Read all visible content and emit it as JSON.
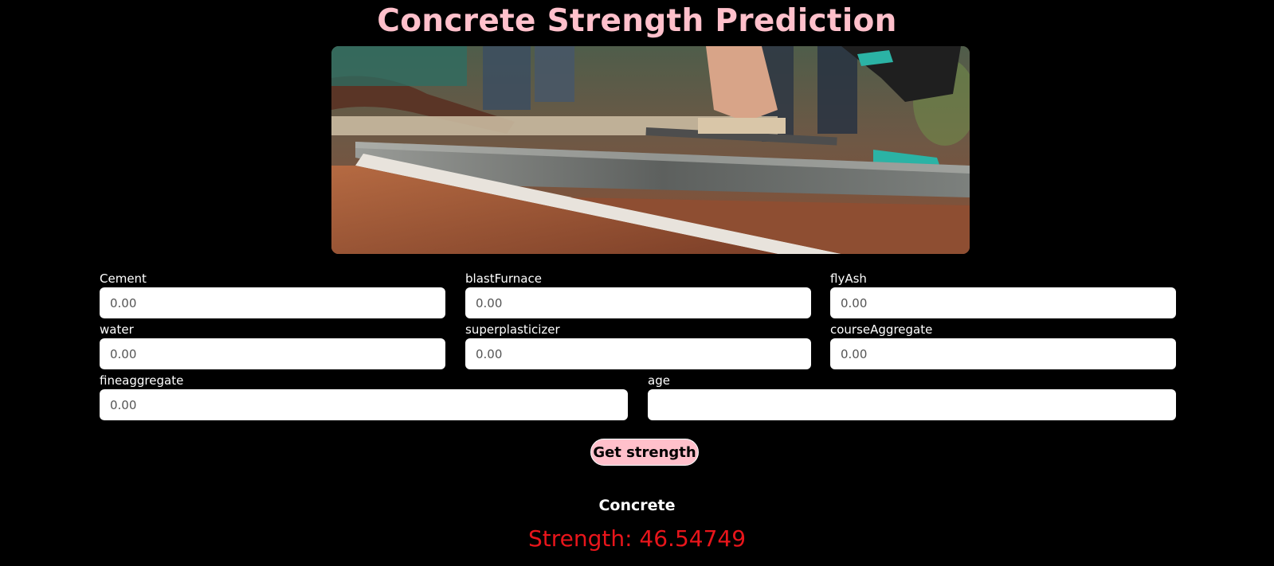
{
  "page": {
    "title": "Concrete Strength Prediction"
  },
  "hero_image": {
    "description_icon": "concrete-pouring-photo"
  },
  "form": {
    "fields": {
      "cement": {
        "label": "Cement",
        "placeholder": "0.00"
      },
      "blast_furnace": {
        "label": "blastFurnace",
        "placeholder": "0.00"
      },
      "fly_ash": {
        "label": "flyAsh",
        "placeholder": "0.00"
      },
      "water": {
        "label": "water",
        "placeholder": "0.00"
      },
      "superplasticizer": {
        "label": "superplasticizer",
        "placeholder": "0.00"
      },
      "course_aggregate": {
        "label": "courseAggregate",
        "placeholder": "0.00"
      },
      "fine_aggregate": {
        "label": "fineaggregate",
        "placeholder": "0.00"
      },
      "age": {
        "label": "age",
        "placeholder": ""
      }
    },
    "submit_label": "Get strength"
  },
  "result": {
    "heading": "Concrete",
    "strength_text": "Strength: 46.54749"
  },
  "colors": {
    "background": "#000000",
    "title": "#ffc0cb",
    "button_bg": "#ffc0cb",
    "result_value": "#e8151b"
  }
}
